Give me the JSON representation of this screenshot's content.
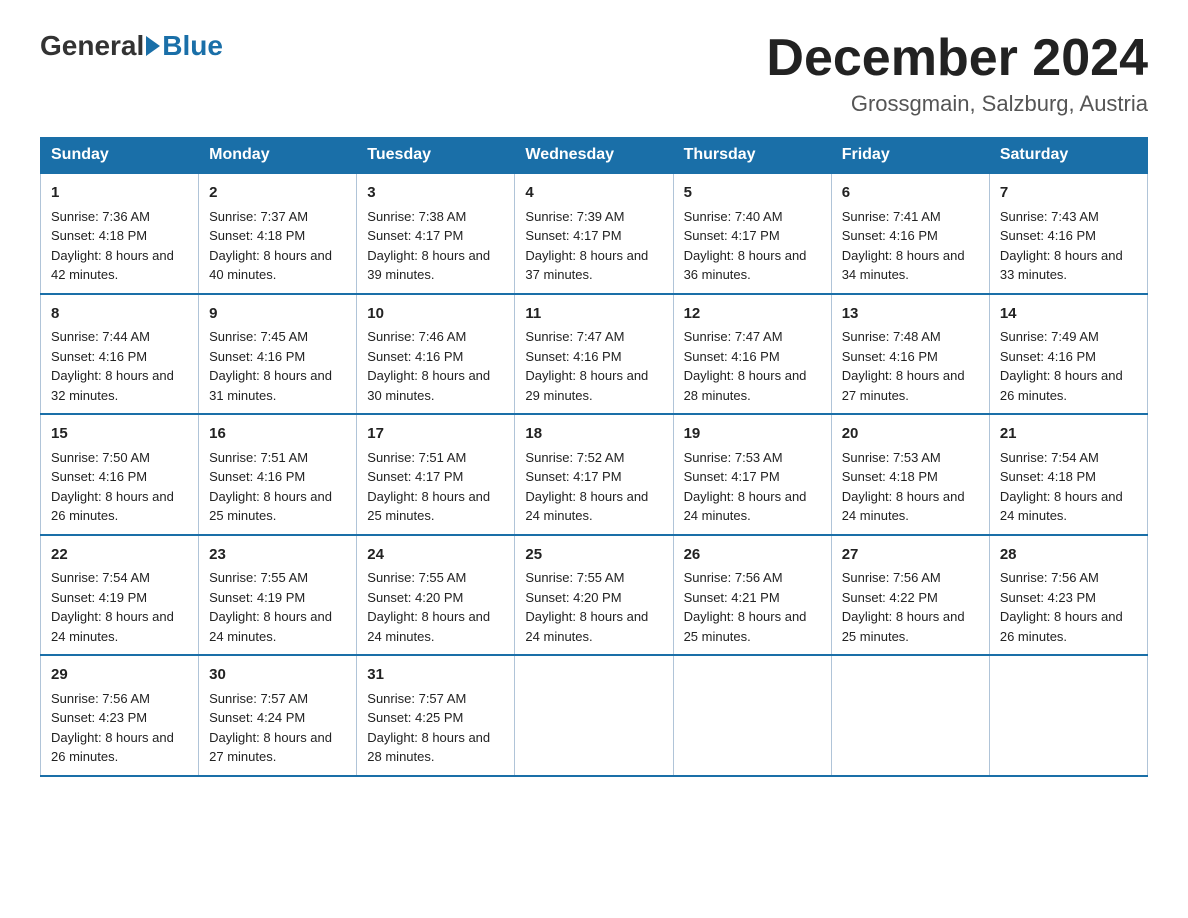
{
  "header": {
    "logo_general": "General",
    "logo_blue": "Blue",
    "month_title": "December 2024",
    "location": "Grossgmain, Salzburg, Austria"
  },
  "weekdays": [
    "Sunday",
    "Monday",
    "Tuesday",
    "Wednesday",
    "Thursday",
    "Friday",
    "Saturday"
  ],
  "weeks": [
    [
      {
        "day": "1",
        "sunrise": "7:36 AM",
        "sunset": "4:18 PM",
        "daylight": "8 hours and 42 minutes."
      },
      {
        "day": "2",
        "sunrise": "7:37 AM",
        "sunset": "4:18 PM",
        "daylight": "8 hours and 40 minutes."
      },
      {
        "day": "3",
        "sunrise": "7:38 AM",
        "sunset": "4:17 PM",
        "daylight": "8 hours and 39 minutes."
      },
      {
        "day": "4",
        "sunrise": "7:39 AM",
        "sunset": "4:17 PM",
        "daylight": "8 hours and 37 minutes."
      },
      {
        "day": "5",
        "sunrise": "7:40 AM",
        "sunset": "4:17 PM",
        "daylight": "8 hours and 36 minutes."
      },
      {
        "day": "6",
        "sunrise": "7:41 AM",
        "sunset": "4:16 PM",
        "daylight": "8 hours and 34 minutes."
      },
      {
        "day": "7",
        "sunrise": "7:43 AM",
        "sunset": "4:16 PM",
        "daylight": "8 hours and 33 minutes."
      }
    ],
    [
      {
        "day": "8",
        "sunrise": "7:44 AM",
        "sunset": "4:16 PM",
        "daylight": "8 hours and 32 minutes."
      },
      {
        "day": "9",
        "sunrise": "7:45 AM",
        "sunset": "4:16 PM",
        "daylight": "8 hours and 31 minutes."
      },
      {
        "day": "10",
        "sunrise": "7:46 AM",
        "sunset": "4:16 PM",
        "daylight": "8 hours and 30 minutes."
      },
      {
        "day": "11",
        "sunrise": "7:47 AM",
        "sunset": "4:16 PM",
        "daylight": "8 hours and 29 minutes."
      },
      {
        "day": "12",
        "sunrise": "7:47 AM",
        "sunset": "4:16 PM",
        "daylight": "8 hours and 28 minutes."
      },
      {
        "day": "13",
        "sunrise": "7:48 AM",
        "sunset": "4:16 PM",
        "daylight": "8 hours and 27 minutes."
      },
      {
        "day": "14",
        "sunrise": "7:49 AM",
        "sunset": "4:16 PM",
        "daylight": "8 hours and 26 minutes."
      }
    ],
    [
      {
        "day": "15",
        "sunrise": "7:50 AM",
        "sunset": "4:16 PM",
        "daylight": "8 hours and 26 minutes."
      },
      {
        "day": "16",
        "sunrise": "7:51 AM",
        "sunset": "4:16 PM",
        "daylight": "8 hours and 25 minutes."
      },
      {
        "day": "17",
        "sunrise": "7:51 AM",
        "sunset": "4:17 PM",
        "daylight": "8 hours and 25 minutes."
      },
      {
        "day": "18",
        "sunrise": "7:52 AM",
        "sunset": "4:17 PM",
        "daylight": "8 hours and 24 minutes."
      },
      {
        "day": "19",
        "sunrise": "7:53 AM",
        "sunset": "4:17 PM",
        "daylight": "8 hours and 24 minutes."
      },
      {
        "day": "20",
        "sunrise": "7:53 AM",
        "sunset": "4:18 PM",
        "daylight": "8 hours and 24 minutes."
      },
      {
        "day": "21",
        "sunrise": "7:54 AM",
        "sunset": "4:18 PM",
        "daylight": "8 hours and 24 minutes."
      }
    ],
    [
      {
        "day": "22",
        "sunrise": "7:54 AM",
        "sunset": "4:19 PM",
        "daylight": "8 hours and 24 minutes."
      },
      {
        "day": "23",
        "sunrise": "7:55 AM",
        "sunset": "4:19 PM",
        "daylight": "8 hours and 24 minutes."
      },
      {
        "day": "24",
        "sunrise": "7:55 AM",
        "sunset": "4:20 PM",
        "daylight": "8 hours and 24 minutes."
      },
      {
        "day": "25",
        "sunrise": "7:55 AM",
        "sunset": "4:20 PM",
        "daylight": "8 hours and 24 minutes."
      },
      {
        "day": "26",
        "sunrise": "7:56 AM",
        "sunset": "4:21 PM",
        "daylight": "8 hours and 25 minutes."
      },
      {
        "day": "27",
        "sunrise": "7:56 AM",
        "sunset": "4:22 PM",
        "daylight": "8 hours and 25 minutes."
      },
      {
        "day": "28",
        "sunrise": "7:56 AM",
        "sunset": "4:23 PM",
        "daylight": "8 hours and 26 minutes."
      }
    ],
    [
      {
        "day": "29",
        "sunrise": "7:56 AM",
        "sunset": "4:23 PM",
        "daylight": "8 hours and 26 minutes."
      },
      {
        "day": "30",
        "sunrise": "7:57 AM",
        "sunset": "4:24 PM",
        "daylight": "8 hours and 27 minutes."
      },
      {
        "day": "31",
        "sunrise": "7:57 AM",
        "sunset": "4:25 PM",
        "daylight": "8 hours and 28 minutes."
      },
      null,
      null,
      null,
      null
    ]
  ]
}
